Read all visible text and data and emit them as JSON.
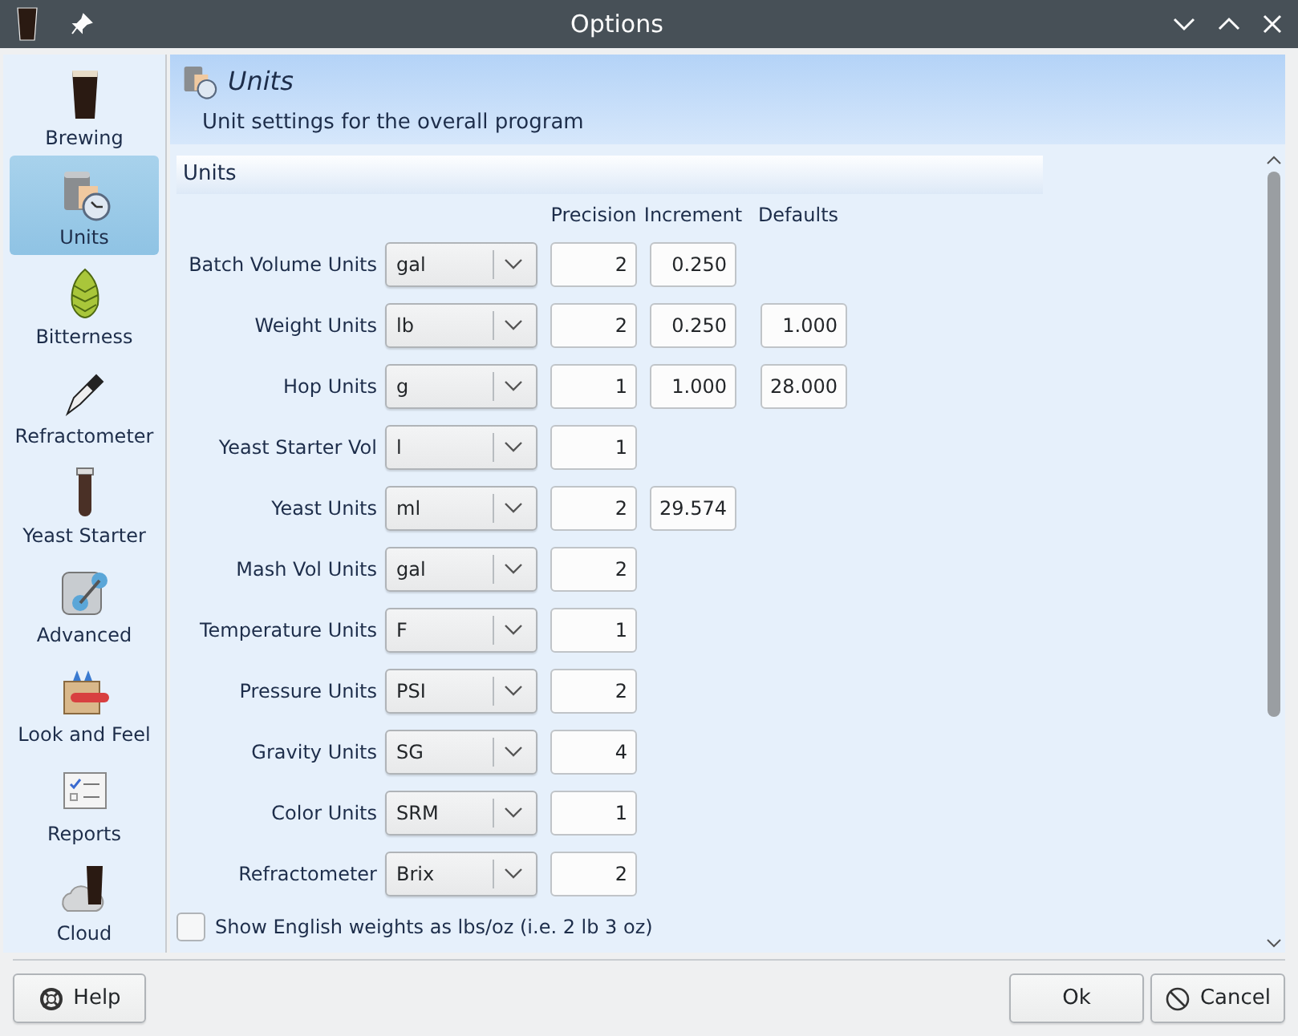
{
  "window": {
    "title": "Options"
  },
  "sidebar": {
    "items": [
      {
        "label": "Brewing",
        "kind": "pint",
        "selected": false
      },
      {
        "label": "Units",
        "kind": "units",
        "selected": true
      },
      {
        "label": "Bitterness",
        "kind": "hop",
        "selected": false
      },
      {
        "label": "Refractometer",
        "kind": "refractometer",
        "selected": false
      },
      {
        "label": "Yeast Starter",
        "kind": "tube",
        "selected": false
      },
      {
        "label": "Advanced",
        "kind": "advanced",
        "selected": false
      },
      {
        "label": "Look and Feel",
        "kind": "crayons",
        "selected": false
      },
      {
        "label": "Reports",
        "kind": "report",
        "selected": false
      },
      {
        "label": "Cloud",
        "kind": "cloud",
        "selected": false
      }
    ]
  },
  "page": {
    "title": "Units",
    "description": "Unit settings for the overall program"
  },
  "group": {
    "title": "Units",
    "columns": [
      "Precision",
      "Increment",
      "Defaults"
    ],
    "rows": [
      {
        "label": "Batch Volume Units",
        "unit": "gal",
        "precision": "2",
        "increment": "0.250"
      },
      {
        "label": "Weight Units",
        "unit": "lb",
        "precision": "2",
        "increment": "0.250",
        "default": "1.000"
      },
      {
        "label": "Hop Units",
        "unit": "g",
        "precision": "1",
        "increment": "1.000",
        "default": "28.000"
      },
      {
        "label": "Yeast Starter Vol",
        "unit": "l",
        "precision": "1"
      },
      {
        "label": "Yeast Units",
        "unit": "ml",
        "precision": "2",
        "increment": "29.574"
      },
      {
        "label": "Mash Vol Units",
        "unit": "gal",
        "precision": "2"
      },
      {
        "label": "Temperature Units",
        "unit": "F",
        "precision": "1"
      },
      {
        "label": "Pressure Units",
        "unit": "PSI",
        "precision": "2"
      },
      {
        "label": "Gravity Units",
        "unit": "SG",
        "precision": "4"
      },
      {
        "label": "Color Units",
        "unit": "SRM",
        "precision": "1"
      },
      {
        "label": "Refractometer",
        "unit": "Brix",
        "precision": "2"
      }
    ],
    "checkbox": {
      "label": "Show English weights as lbs/oz (i.e. 2 lb 3 oz)",
      "checked": false
    }
  },
  "buttons": {
    "help": "Help",
    "ok": "Ok",
    "cancel": "Cancel"
  }
}
